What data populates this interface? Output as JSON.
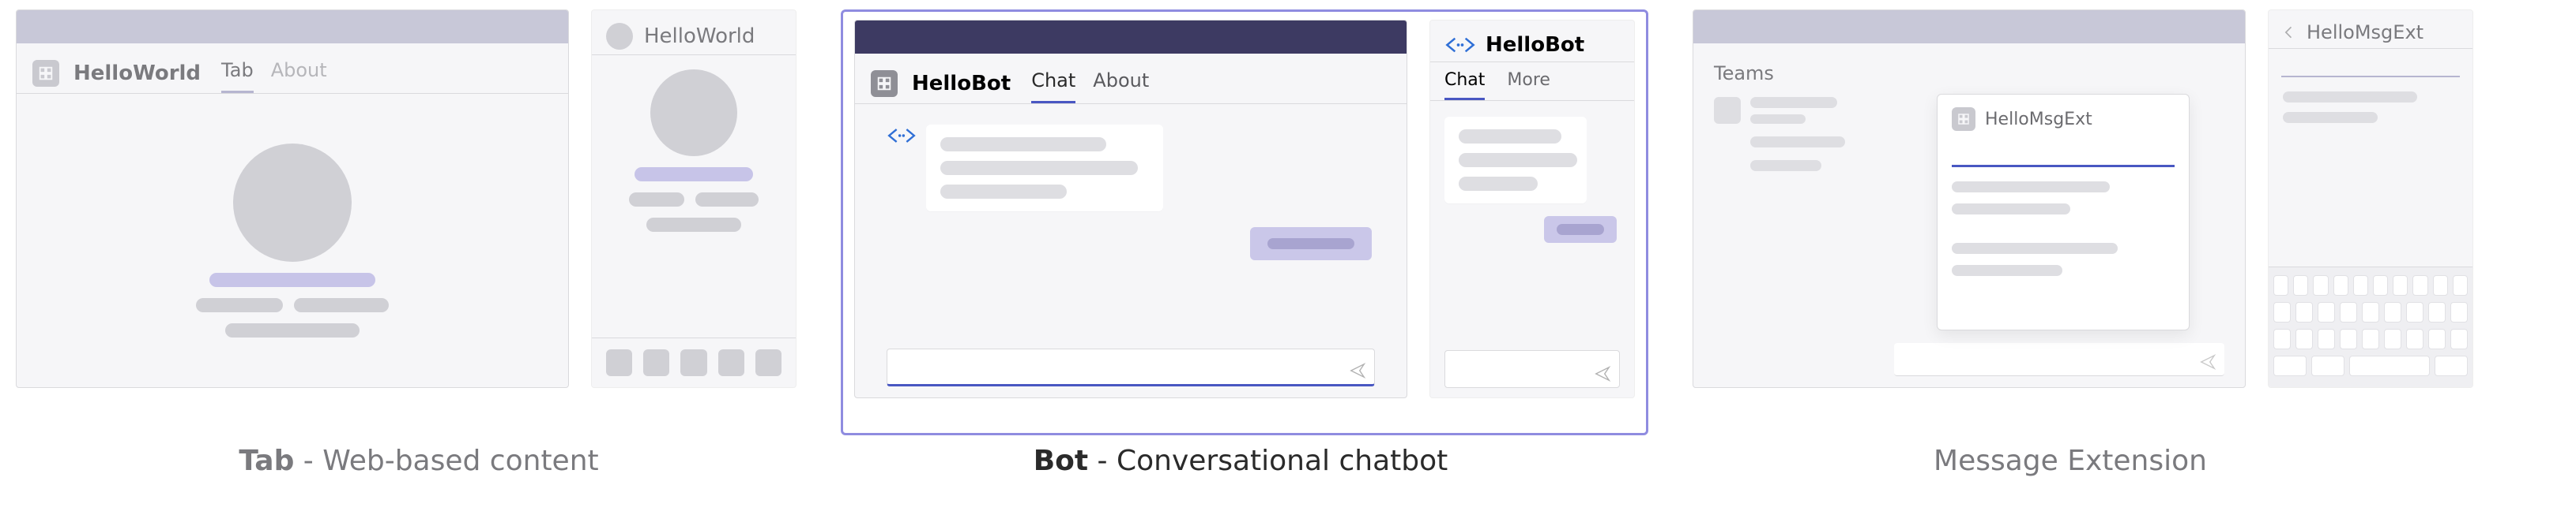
{
  "tabPanel": {
    "desktop": {
      "app_name": "HelloWorld",
      "tabs": {
        "tab1": "Tab",
        "tab2": "About"
      }
    },
    "mobile": {
      "app_name": "HelloWorld"
    },
    "caption_strong": "Tab",
    "caption_rest": " - Web-based content"
  },
  "botPanel": {
    "desktop": {
      "app_name": "HelloBot",
      "tabs": {
        "tab1": "Chat",
        "tab2": "About"
      }
    },
    "mobile": {
      "app_name": "HelloBot",
      "tabs": {
        "tab1": "Chat",
        "tab2": "More"
      }
    },
    "caption_strong": "Bot",
    "caption_rest": " - Conversational chatbot"
  },
  "msgextPanel": {
    "desktop": {
      "sidebar_label": "Teams",
      "popover_title": "HelloMsgExt"
    },
    "mobile": {
      "app_name": "HelloMsgExt"
    },
    "caption_strong": "Message Extension"
  }
}
